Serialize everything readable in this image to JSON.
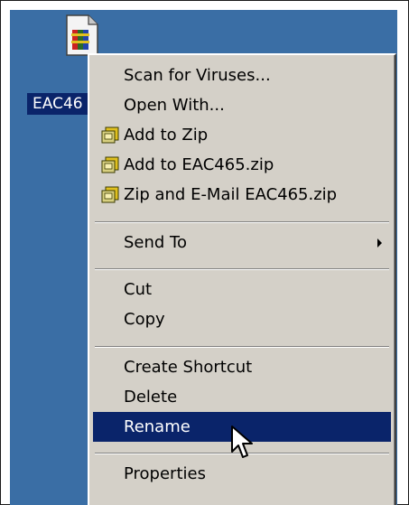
{
  "desktop": {
    "file_icon": "winzip-archive-icon",
    "file_label": "EAC46"
  },
  "context_menu": {
    "items": [
      {
        "label": "Scan for Viruses...",
        "icon": null
      },
      {
        "label": "Open With...",
        "icon": null
      },
      {
        "label": "Add to Zip",
        "icon": "winzip-icon"
      },
      {
        "label": "Add to EAC465.zip",
        "icon": "winzip-icon"
      },
      {
        "label": "Zip and E-Mail EAC465.zip",
        "icon": "winzip-icon"
      },
      {
        "label": "Send To",
        "icon": null,
        "submenu": true
      },
      {
        "label": "Cut",
        "icon": null
      },
      {
        "label": "Copy",
        "icon": null
      },
      {
        "label": "Create Shortcut",
        "icon": null
      },
      {
        "label": "Delete",
        "icon": null
      },
      {
        "label": "Rename",
        "icon": null,
        "highlighted": true
      },
      {
        "label": "Properties",
        "icon": null
      }
    ]
  },
  "colors": {
    "desktop": "#3a6ea5",
    "menu_bg": "#d4d0c8",
    "highlight": "#0a246a"
  },
  "cursor": "mouse-pointer-icon"
}
